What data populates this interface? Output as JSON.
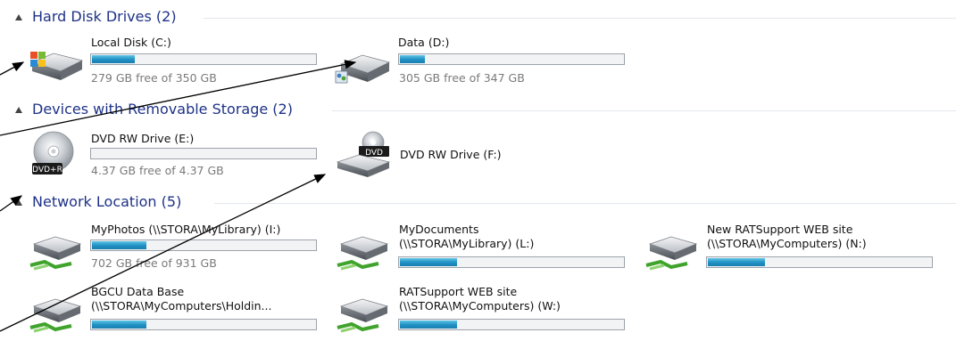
{
  "groups": {
    "hard_disk": {
      "title": "Hard Disk Drives (2)"
    },
    "removable": {
      "title": "Devices with Removable Storage (2)"
    },
    "network": {
      "title": "Network Location (5)"
    }
  },
  "drives": {
    "c": {
      "name": "Local Disk (C:)",
      "free": "279 GB free of 350 GB",
      "used_fraction": 0.2
    },
    "d": {
      "name": "Data (D:)",
      "free": "305 GB free of 347 GB",
      "used_fraction": 0.12
    },
    "e": {
      "name": "DVD RW Drive (E:)",
      "free": "4.37 GB free of 4.37 GB",
      "used_fraction": 0.0,
      "disc_label": "DVD+R"
    },
    "f": {
      "name": "DVD RW Drive (F:)",
      "disc_label": "DVD"
    },
    "i": {
      "name": "MyPhotos (\\\\STORA\\MyLibrary) (I:)",
      "free": "702 GB free of 931 GB",
      "used_fraction": 0.25
    },
    "l": {
      "name_line1": "MyDocuments",
      "name_line2": "(\\\\STORA\\MyLibrary) (L:)",
      "used_fraction": 0.26
    },
    "n": {
      "name_line1": "New RATSupport WEB site",
      "name_line2": "(\\\\STORA\\MyComputers) (N:)",
      "used_fraction": 0.26
    },
    "bgcu": {
      "name_line1": "BGCU Data Base",
      "name_line2": "(\\\\STORA\\MyComputers\\Holdin...",
      "used_fraction": 0.25
    },
    "w": {
      "name_line1": "RATSupport WEB site",
      "name_line2": "(\\\\STORA\\MyComputers) (W:)",
      "used_fraction": 0.26
    }
  },
  "colors": {
    "group_title": "#1e3287",
    "bar_fill": "#1f8fc2",
    "annotation_line": "#000000"
  }
}
